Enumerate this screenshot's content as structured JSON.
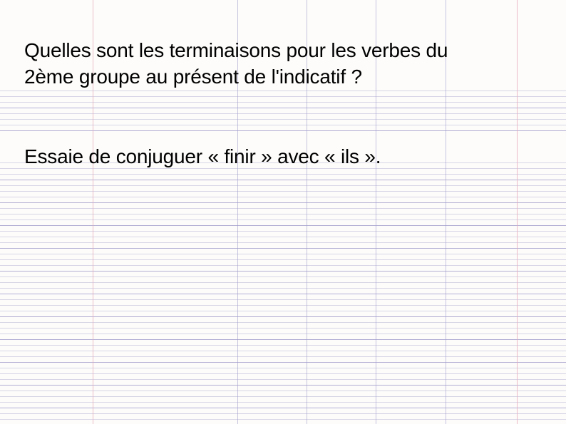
{
  "questions": {
    "q1_line1": "Quelles sont les terminaisons pour les verbes du",
    "q1_line2": "2ème groupe au présent de l'indicatif ?",
    "q2": "Essaie de conjuguer « finir » avec « ils »."
  }
}
